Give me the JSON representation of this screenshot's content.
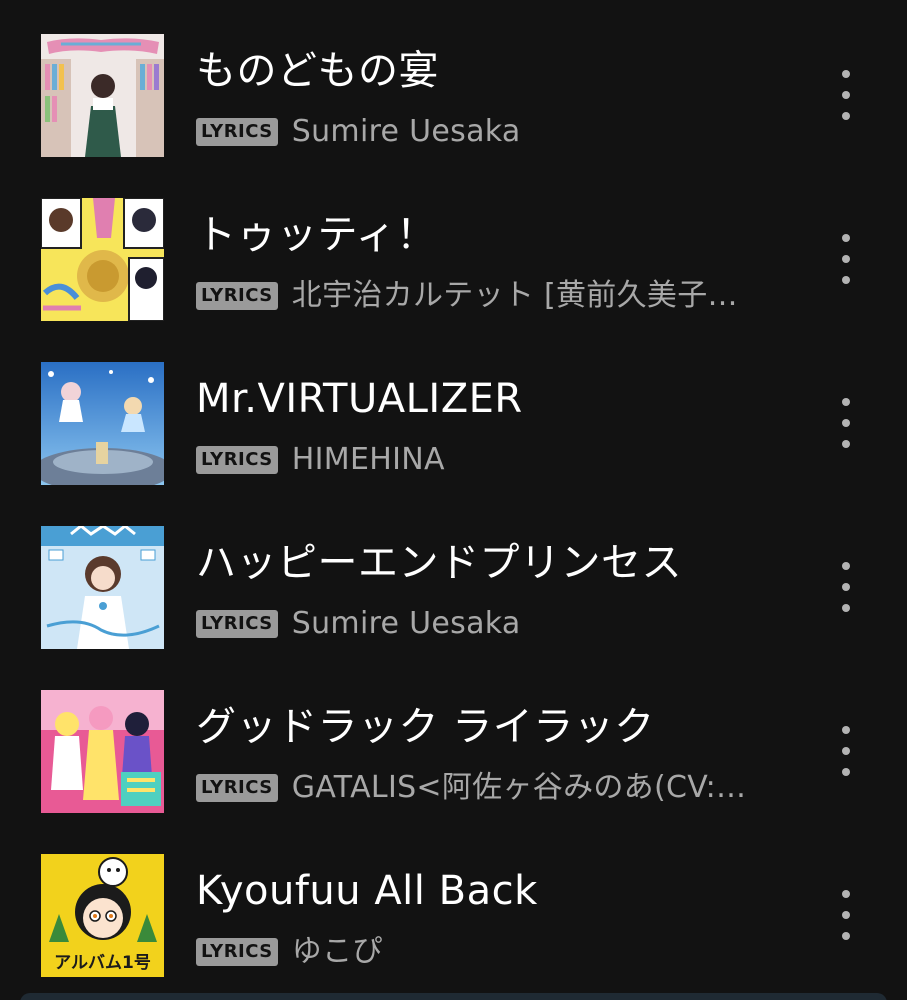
{
  "tracks": [
    {
      "title": "ものどもの宴",
      "badge": "LYRICS",
      "artist": "Sumire Uesaka",
      "art_colors": {
        "bg": "#efe8e6",
        "accent": "#e58fb5",
        "accent2": "#6aaed6"
      },
      "art_icon": "album-cover-bookshelf-girl"
    },
    {
      "title": "トゥッティ！",
      "badge": "LYRICS",
      "artist": "北宇治カルテット [黄前久美子…",
      "art_colors": {
        "bg": "#f7e55a",
        "accent": "#e07fb0",
        "accent2": "#4a8fd8"
      },
      "art_icon": "album-cover-quartet"
    },
    {
      "title": "Mr.VIRTUALIZER",
      "badge": "LYRICS",
      "artist": "HIMEHINA",
      "art_colors": {
        "bg": "#3f86d6",
        "accent": "#c9e6ff",
        "accent2": "#e6d3a0"
      },
      "art_icon": "album-cover-stadium"
    },
    {
      "title": "ハッピーエンドプリンセス",
      "badge": "LYRICS",
      "artist": "Sumire Uesaka",
      "art_colors": {
        "bg": "#cfe6f6",
        "accent": "#ffffff",
        "accent2": "#4a9fd4"
      },
      "art_icon": "album-cover-princess"
    },
    {
      "title": "グッドラック ライラック",
      "badge": "LYRICS",
      "artist": "GATALIS<阿佐ヶ谷みのあ(CV:…",
      "art_colors": {
        "bg": "#e85a95",
        "accent": "#ffe36a",
        "accent2": "#6a52c8"
      },
      "art_icon": "album-cover-idol-group"
    },
    {
      "title": "Kyoufuu All Back",
      "badge": "LYRICS",
      "artist": "ゆこぴ",
      "art_colors": {
        "bg": "#f2d21c",
        "accent": "#1b1b1b",
        "accent2": "#3a8a3a"
      },
      "art_icon": "album-cover-album1",
      "art_text": "アルバム1号"
    }
  ]
}
